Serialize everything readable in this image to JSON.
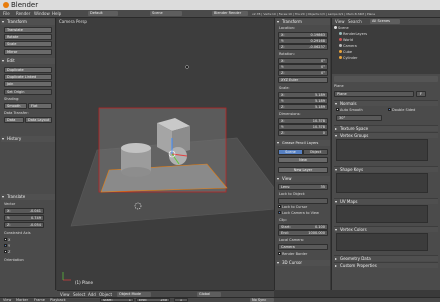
{
  "window": {
    "title": "Blender"
  },
  "topbar": {
    "menus": [
      "File",
      "Render",
      "Window",
      "Help"
    ],
    "layout": "Default",
    "scene": "Scene",
    "engine": "Blender Render",
    "stats": "v2.78 | Verts:10 | Faces:10 | Tris:20 | Objects:1/3 | Lamps:0/1 | Mem:8.34M | Plane"
  },
  "tools": {
    "transform_header": "Transform",
    "translate": "Translate",
    "rotate": "Rotate",
    "scale": "Scale",
    "mirror": "Mirror",
    "edit_header": "Edit",
    "duplicate": "Duplicate",
    "duplicate_linked": "Duplicate Linked",
    "join": "Join",
    "set_origin": "Set Origin",
    "shading_label": "Shading:",
    "smooth": "Smooth",
    "flat": "Flat",
    "data_transfer_label": "Data Transfer:",
    "data": "Data",
    "data_layout": "Data Layout",
    "history_header": "History"
  },
  "operator": {
    "header": "Translate",
    "vector_label": "Vector",
    "x_label": "X:",
    "x": "-0.041",
    "y_label": "Y:",
    "y": "0.749",
    "z_label": "Z:",
    "z": "-0.054",
    "constraint_label": "Constraint Axis",
    "cx": "X",
    "cy": "Y",
    "cz": "Z",
    "orientation_label": "Orientation"
  },
  "viewport": {
    "camera_label": "Camera Persp",
    "object_label": "(1) Plane"
  },
  "npanel": {
    "transform_header": "Transform",
    "location_label": "Location:",
    "loc_x": "0.19863",
    "loc_y": "0.29168",
    "loc_z": "-0.06237",
    "rotation_label": "Rotation:",
    "rot_x": "0°",
    "rot_y": "0°",
    "rot_z": "0°",
    "euler": "XYZ Euler",
    "scale_label": "Scale:",
    "scale_x": "5.189",
    "scale_y": "5.189",
    "scale_z": "5.189",
    "dimensions_label": "Dimensions:",
    "dim_x": "10.378",
    "dim_y": "10.378",
    "dim_z": "0",
    "grease_header": "Grease Pencil Layers",
    "scene_tab": "Scene",
    "object_tab": "Object",
    "new_btn": "New",
    "new_layer_btn": "New Layer",
    "view_header": "View",
    "lens_label": "Lens:",
    "lens": "35",
    "lock_label": "Lock to Object:",
    "lock_cursor": "Lock to Cursor",
    "lock_camera": "Lock Camera to View",
    "clip_label": "Clip:",
    "clip_start_label": "Start:",
    "clip_start": "0.100",
    "clip_end_label": "End:",
    "clip_end": "1000.000",
    "local_camera": "Local Camera:",
    "camera_field": "Camera",
    "render_border": "Render Border",
    "cursor_header": "3D Cursor"
  },
  "outliner": {
    "view": "View",
    "search": "Search",
    "all_scenes": "All Scenes",
    "items": [
      "Scene",
      "RenderLayers",
      "World",
      "Camera",
      "Cube",
      "Cylinder"
    ]
  },
  "properties": {
    "tabs_row": "Plane",
    "mesh_name": "Plane",
    "fake_user": "F",
    "normals_header": "Normals",
    "auto_smooth": "Auto Smooth",
    "double_sided": "Double Sided",
    "angle": "30°",
    "texture_space": "Texture Space",
    "vertex_groups": "Vertex Groups",
    "shape_keys": "Shape Keys",
    "uv_maps": "UV Maps",
    "vertex_colors": "Vertex Colors",
    "geometry_data": "Geometry Data",
    "custom_props": "Custom Properties"
  },
  "viewbar": {
    "view": "View",
    "select": "Select",
    "add": "Add",
    "object": "Object",
    "mode": "Object Mode",
    "orientation": "Global"
  },
  "bottom": {
    "view": "View",
    "marker": "Marker",
    "frame": "Frame",
    "playback": "Playback",
    "start_label": "Start:",
    "start": "1",
    "end_label": "End:",
    "end": "250",
    "current": "1",
    "sync": "No Sync"
  },
  "colors": {
    "accent": "#5680c2",
    "selection": "#e87d0d",
    "panel": "#4b4b4b",
    "viewport": "#3d3d3d"
  }
}
